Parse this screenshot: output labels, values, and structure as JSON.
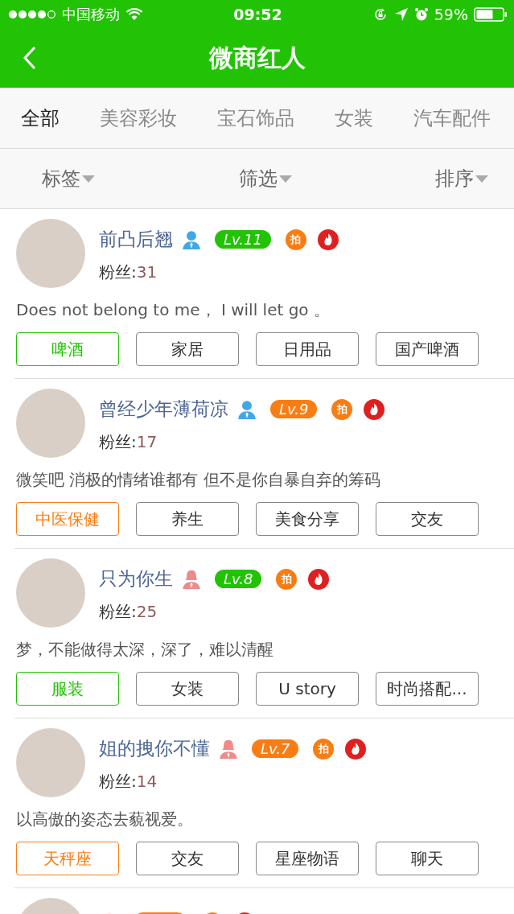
{
  "status_bar": {
    "carrier": "中国移动",
    "time": "09:52",
    "battery": "59%"
  },
  "nav": {
    "title": "微商红人"
  },
  "tabs": [
    {
      "label": "全部",
      "selected": true
    },
    {
      "label": "美容彩妆",
      "selected": false
    },
    {
      "label": "宝石饰品",
      "selected": false
    },
    {
      "label": "女装",
      "selected": false
    },
    {
      "label": "汽车配件",
      "selected": false
    }
  ],
  "filters": [
    "标签",
    "筛选",
    "排序"
  ],
  "users": [
    {
      "kind": "full",
      "name": "前凸后翘",
      "female": false,
      "level": "Lv.11",
      "color": "#22c304",
      "badge": "拍",
      "fans_label": "粉丝:",
      "fans": "31",
      "bio": "Does not belong to me，  I will let go 。",
      "tags": [
        {
          "label": "啤酒",
          "color": "#22c304"
        },
        {
          "label": "家居"
        },
        {
          "label": "日用品"
        },
        {
          "label": "国产啤酒"
        }
      ]
    },
    {
      "kind": "full",
      "name": "曾经少年薄荷凉",
      "female": false,
      "level": "Lv.9",
      "color": "#f97d13",
      "badge": "拍",
      "fans_label": "粉丝:",
      "fans": "17",
      "bio": "微笑吧 消极的情绪谁都有 但不是你自暴自弃的筹码",
      "tags": [
        {
          "label": "中医保健",
          "color": "#f97d13"
        },
        {
          "label": "养生"
        },
        {
          "label": "美食分享"
        },
        {
          "label": "交友"
        }
      ]
    },
    {
      "kind": "full",
      "name": "只为你生",
      "female": true,
      "level": "Lv.8",
      "color": "#22c304",
      "badge": "拍",
      "fans_label": "粉丝:",
      "fans": "25",
      "bio": "梦，不能做得太深，深了，难以清醒",
      "tags": [
        {
          "label": "服装",
          "color": "#22c304"
        },
        {
          "label": "女装"
        },
        {
          "label": "U story"
        },
        {
          "label": "时尚搭配..."
        }
      ]
    },
    {
      "kind": "full",
      "name": "姐的拽你不懂",
      "female": true,
      "level": "Lv.7",
      "color": "#f97d13",
      "badge": "拍",
      "fans_label": "粉丝:",
      "fans": "14",
      "bio": "以高傲的姿态去藐视爱。",
      "tags": [
        {
          "label": "天秤座",
          "color": "#f97d13"
        },
        {
          "label": "交友"
        },
        {
          "label": "星座物语"
        },
        {
          "label": "聊天"
        }
      ]
    },
    {
      "kind": "partial",
      "female": true,
      "color": "#f97d13"
    }
  ]
}
